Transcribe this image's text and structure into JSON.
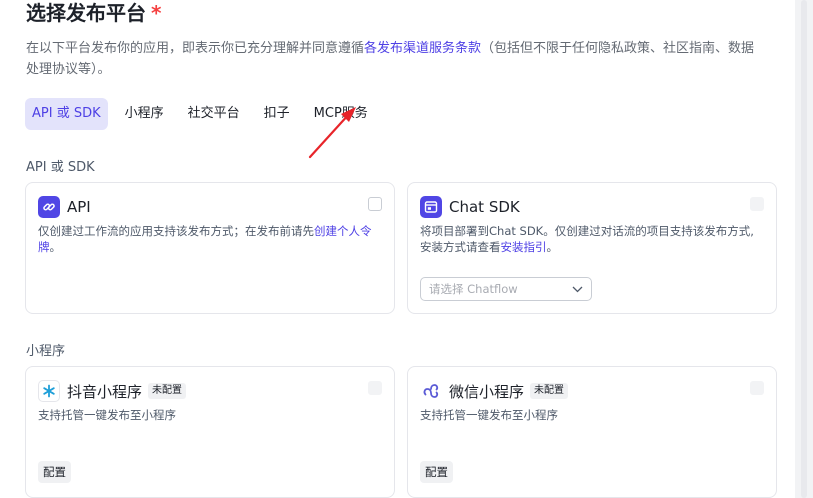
{
  "header": {
    "title": "选择发布平台",
    "required_mark": "*",
    "desc_prefix": "在以下平台发布你的应用，即表示你已充分理解并同意遵循",
    "desc_link": "各发布渠道服务条款",
    "desc_suffix": "（包括但不限于任何隐私政策、社区指南、数据处理协议等）。"
  },
  "tabs": [
    {
      "label": "API 或 SDK",
      "active": true
    },
    {
      "label": "小程序"
    },
    {
      "label": "社交平台"
    },
    {
      "label": "扣子"
    },
    {
      "label": "MCP服务"
    }
  ],
  "sections": {
    "api_sdk": {
      "label": "API 或 SDK",
      "api": {
        "name": "API",
        "desc": "仅创建过工作流的应用支持该发布方式；在发布前请先",
        "desc_link": "创建个人令牌",
        "desc_end": "。"
      },
      "chat_sdk": {
        "name": "Chat SDK",
        "desc": "将项目部署到Chat SDK。仅创建过对话流的项目支持该发布方式,安装方式请查看",
        "desc_link": "安装指引",
        "desc_end": "。",
        "select_placeholder": "请选择 Chatflow"
      }
    },
    "mini_program": {
      "label": "小程序",
      "douyin": {
        "name": "抖音小程序",
        "badge": "未配置",
        "desc": "支持托管一键发布至小程序",
        "config_label": "配置"
      },
      "wechat": {
        "name": "微信小程序",
        "badge": "未配置",
        "desc": "支持托管一键发布至小程序",
        "config_label": "配置"
      }
    }
  },
  "colors": {
    "accent": "#4e40e5",
    "tab_active_bg": "#e3e3fb",
    "required": "#f53f3f",
    "annotation_arrow": "#e8242a"
  }
}
